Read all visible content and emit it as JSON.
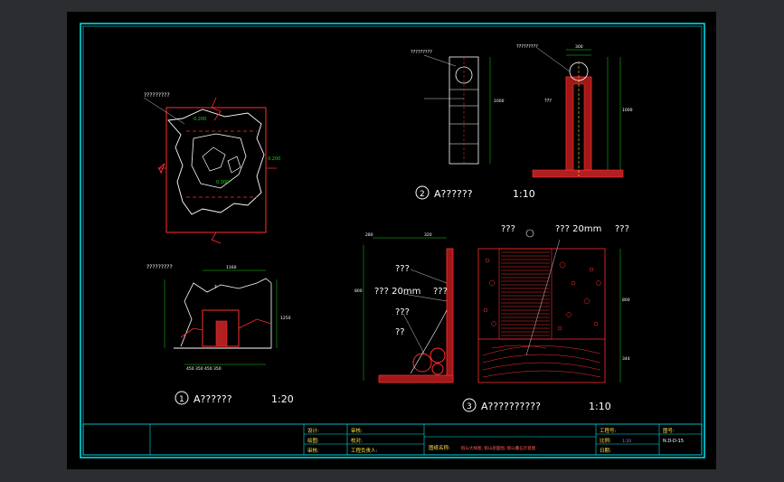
{
  "drawing": {
    "detail1": {
      "number": "1",
      "title": "A??????",
      "scale": "1:20",
      "callout": "?????????"
    },
    "detail2": {
      "number": "2",
      "title": "A??????",
      "scale": "1:10",
      "callout_left": "?????????",
      "callout_right": "?????????",
      "side_label": "???"
    },
    "detail3": {
      "number": "3",
      "title": "A??????????",
      "scale": "1:10",
      "left_labels": [
        "???",
        "??? 20mm",
        "???",
        "???",
        "??"
      ],
      "right_labels": [
        "???",
        "??? 20mm",
        "???"
      ]
    },
    "plan": {
      "callout": "?????????"
    }
  },
  "title_block": {
    "design_label": "设计:",
    "check_label": "审核:",
    "draw_label": "绘图:",
    "proof_label": "校对:",
    "approve_label": "审核:",
    "project_label": "工程负责人:",
    "drawing_name_label": "图纸名称:",
    "drawing_name_value": "假山大样图, 假山剖面图, 假山叠石示意图",
    "project_no_label": "工程号:",
    "scale_label": "比例:",
    "scale_value": "1:20",
    "date_label": "日期:",
    "sheet_no_label": "图号:",
    "sheet_no_value": "N.D-D-15"
  },
  "colors": {
    "border": "#00e5ef",
    "lines": "#ff2e2e",
    "dims": "#19d419",
    "text": "#ffffff",
    "accent": "#ffe24a"
  }
}
